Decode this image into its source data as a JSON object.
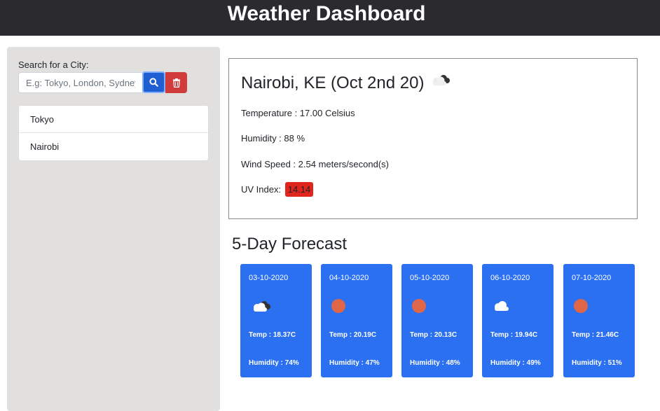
{
  "header": {
    "title": "Weather Dashboard"
  },
  "sidebar": {
    "search_label": "Search for a City:",
    "search_placeholder": "E.g: Tokyo, London, Sydney",
    "search_value": "",
    "search_button_icon": "search-icon",
    "clear_button_icon": "trash-icon",
    "cities": [
      {
        "label": "Tokyo"
      },
      {
        "label": "Nairobi"
      }
    ]
  },
  "current": {
    "title": "Nairobi, KE (Oct 2nd 20)",
    "icon": "cloudy-icon",
    "temperature": "Temperature : 17.00 Celsius",
    "humidity": "Humidity : 88 %",
    "wind": "Wind Speed : 2.54 meters/second(s)",
    "uv_label": "UV Index:",
    "uv_value": "14.14",
    "uv_color": "#e0251c"
  },
  "forecast": {
    "title": "5-Day Forecast",
    "accent": "#2a70f0",
    "days": [
      {
        "date": "03-10-2020",
        "icon": "cloudy-icon",
        "temp": "Temp : 18.37C",
        "humidity": "Humidity : 74%"
      },
      {
        "date": "04-10-2020",
        "icon": "sun-icon",
        "temp": "Temp : 20.19C",
        "humidity": "Humidity : 47%"
      },
      {
        "date": "05-10-2020",
        "icon": "sun-icon",
        "temp": "Temp : 20.13C",
        "humidity": "Humidity : 48%"
      },
      {
        "date": "06-10-2020",
        "icon": "cloud-icon",
        "temp": "Temp : 19.94C",
        "humidity": "Humidity : 49%"
      },
      {
        "date": "07-10-2020",
        "icon": "sun-icon",
        "temp": "Temp : 21.46C",
        "humidity": "Humidity : 51%"
      }
    ]
  }
}
